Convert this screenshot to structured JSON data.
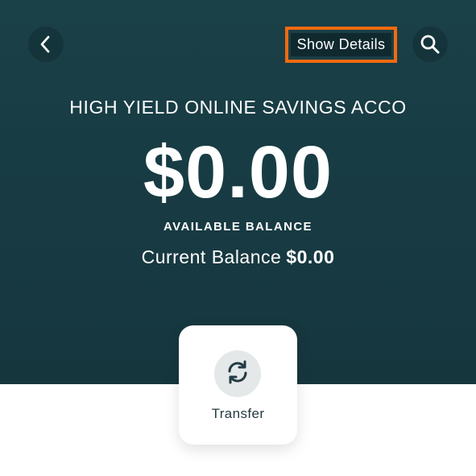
{
  "header": {
    "back_icon": "chevron-left-icon",
    "show_details_label": "Show Details",
    "search_icon": "search-icon"
  },
  "account": {
    "name": "HIGH YIELD ONLINE SAVINGS ACCO",
    "balance": "$0.00",
    "available_label": "AVAILABLE BALANCE",
    "current_balance_label": "Current Balance",
    "current_balance_value": "$0.00"
  },
  "actions": {
    "transfer_label": "Transfer",
    "transfer_icon": "transfer-icon"
  },
  "colors": {
    "hero_background": "#1a4048",
    "highlight": "#f26a10",
    "card_background": "#ffffff",
    "icon_circle": "#e4e8e9"
  }
}
